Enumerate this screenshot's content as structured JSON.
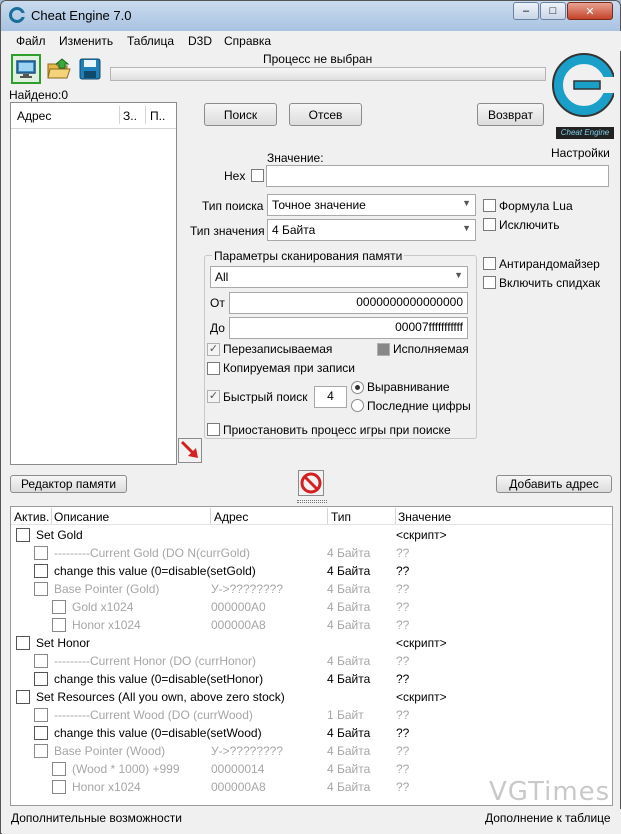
{
  "window": {
    "title": "Cheat Engine 7.0",
    "minimize_label": "–",
    "maximize_label": "□",
    "close_label": "✕"
  },
  "menu": [
    "Файл",
    "Изменить",
    "Таблица",
    "D3D",
    "Справка"
  ],
  "toolbar": {
    "icons": [
      "select-process-icon",
      "open-file-icon",
      "save-icon"
    ]
  },
  "process_label": "Процесс не выбран",
  "found_label": "Найдено:0",
  "address_list": {
    "columns": [
      "Адрес",
      "З..",
      "П.."
    ]
  },
  "scan_buttons": {
    "first_scan": "Поиск",
    "next_scan": "Отсев",
    "undo_scan": "Возврат"
  },
  "logo": {
    "text": "Cheat Engine",
    "settings": "Настройки"
  },
  "value": {
    "label": "Значение:",
    "hex_label": "Hex",
    "input": ""
  },
  "scan_type": {
    "label": "Тип поиска",
    "selected": "Точное значение"
  },
  "value_type": {
    "label": "Тип значения",
    "selected": "4 Байта"
  },
  "options_right": {
    "lua_formula": "Формула Lua",
    "exclude": "Исключить",
    "unrandomizer": "Антирандомайзер",
    "speedhack": "Включить спидхак"
  },
  "memory_scan": {
    "title": "Параметры сканирования памяти",
    "region": "All",
    "from_label": "От",
    "from_value": "0000000000000000",
    "to_label": "До",
    "to_value": "00007fffffffffff",
    "writable": "Перезаписываемая",
    "executable": "Исполняемая",
    "copy_on_write": "Копируемая при записи",
    "fast_scan": "Быстрый поиск",
    "fast_scan_value": "4",
    "alignment": "Выравнивание",
    "last_digits": "Последние цифры",
    "pause_game": "Приостановить процесс игры при поиске"
  },
  "bottom_buttons": {
    "memory_view": "Редактор памяти",
    "add_address": "Добавить адрес"
  },
  "cheat_table": {
    "columns": [
      "Актив.",
      "Описание",
      "Адрес",
      "Тип",
      "Значение"
    ],
    "rows": [
      {
        "indent": 0,
        "desc": "Set Gold",
        "addr": "",
        "type": "",
        "value": "<скрипт>",
        "style": "bold"
      },
      {
        "indent": 1,
        "desc": "---------Current Gold  (DO N(currGold)",
        "addr": "",
        "type": "4 Байта",
        "value": "??",
        "style": "grey"
      },
      {
        "indent": 1,
        "desc": "change this value  (0=disable(setGold)",
        "addr": "",
        "type": "4 Байта",
        "value": "??",
        "style": "bold"
      },
      {
        "indent": 1,
        "desc": "Base Pointer (Gold)",
        "addr": "У->????????",
        "type": "4 Байта",
        "value": "??",
        "style": "grey"
      },
      {
        "indent": 2,
        "desc": "Gold x1024",
        "addr": "000000A0",
        "type": "4 Байта",
        "value": "??",
        "style": "grey"
      },
      {
        "indent": 2,
        "desc": "Honor x1024",
        "addr": "000000A8",
        "type": "4 Байта",
        "value": "??",
        "style": "grey"
      },
      {
        "indent": 0,
        "desc": "Set Honor",
        "addr": "",
        "type": "",
        "value": "<скрипт>",
        "style": "bold"
      },
      {
        "indent": 1,
        "desc": "---------Current Honor  (DO (currHonor)",
        "addr": "",
        "type": "4 Байта",
        "value": "??",
        "style": "grey"
      },
      {
        "indent": 1,
        "desc": "change this value  (0=disable(setHonor)",
        "addr": "",
        "type": "4 Байта",
        "value": "??",
        "style": "bold"
      },
      {
        "indent": 0,
        "desc": "Set Resources  (All you own, above zero stock)",
        "addr": "",
        "type": "",
        "value": "<скрипт>",
        "style": "bold"
      },
      {
        "indent": 1,
        "desc": "---------Current Wood  (DO (currWood)",
        "addr": "",
        "type": "1 Байт",
        "value": "??",
        "style": "grey"
      },
      {
        "indent": 1,
        "desc": "change this value  (0=disable(setWood)",
        "addr": "",
        "type": "4 Байта",
        "value": "??",
        "style": "bold"
      },
      {
        "indent": 1,
        "desc": "Base Pointer (Wood)",
        "addr": "У->????????",
        "type": "4 Байта",
        "value": "??",
        "style": "grey"
      },
      {
        "indent": 2,
        "desc": "(Wood * 1000) +999",
        "addr": "00000014",
        "type": "4 Байта",
        "value": "??",
        "style": "grey"
      },
      {
        "indent": 2,
        "desc": "Honor x1024",
        "addr": "000000A8",
        "type": "4 Байта",
        "value": "??",
        "style": "grey"
      }
    ]
  },
  "status": {
    "left": "Дополнительные возможности",
    "right": "Дополнение к таблице"
  },
  "watermark": "VGTimes",
  "colors": {
    "accent": "#1aa0c8",
    "selected_tool_border": "#2f9e2f",
    "grey_text": "#a6a6a6"
  }
}
